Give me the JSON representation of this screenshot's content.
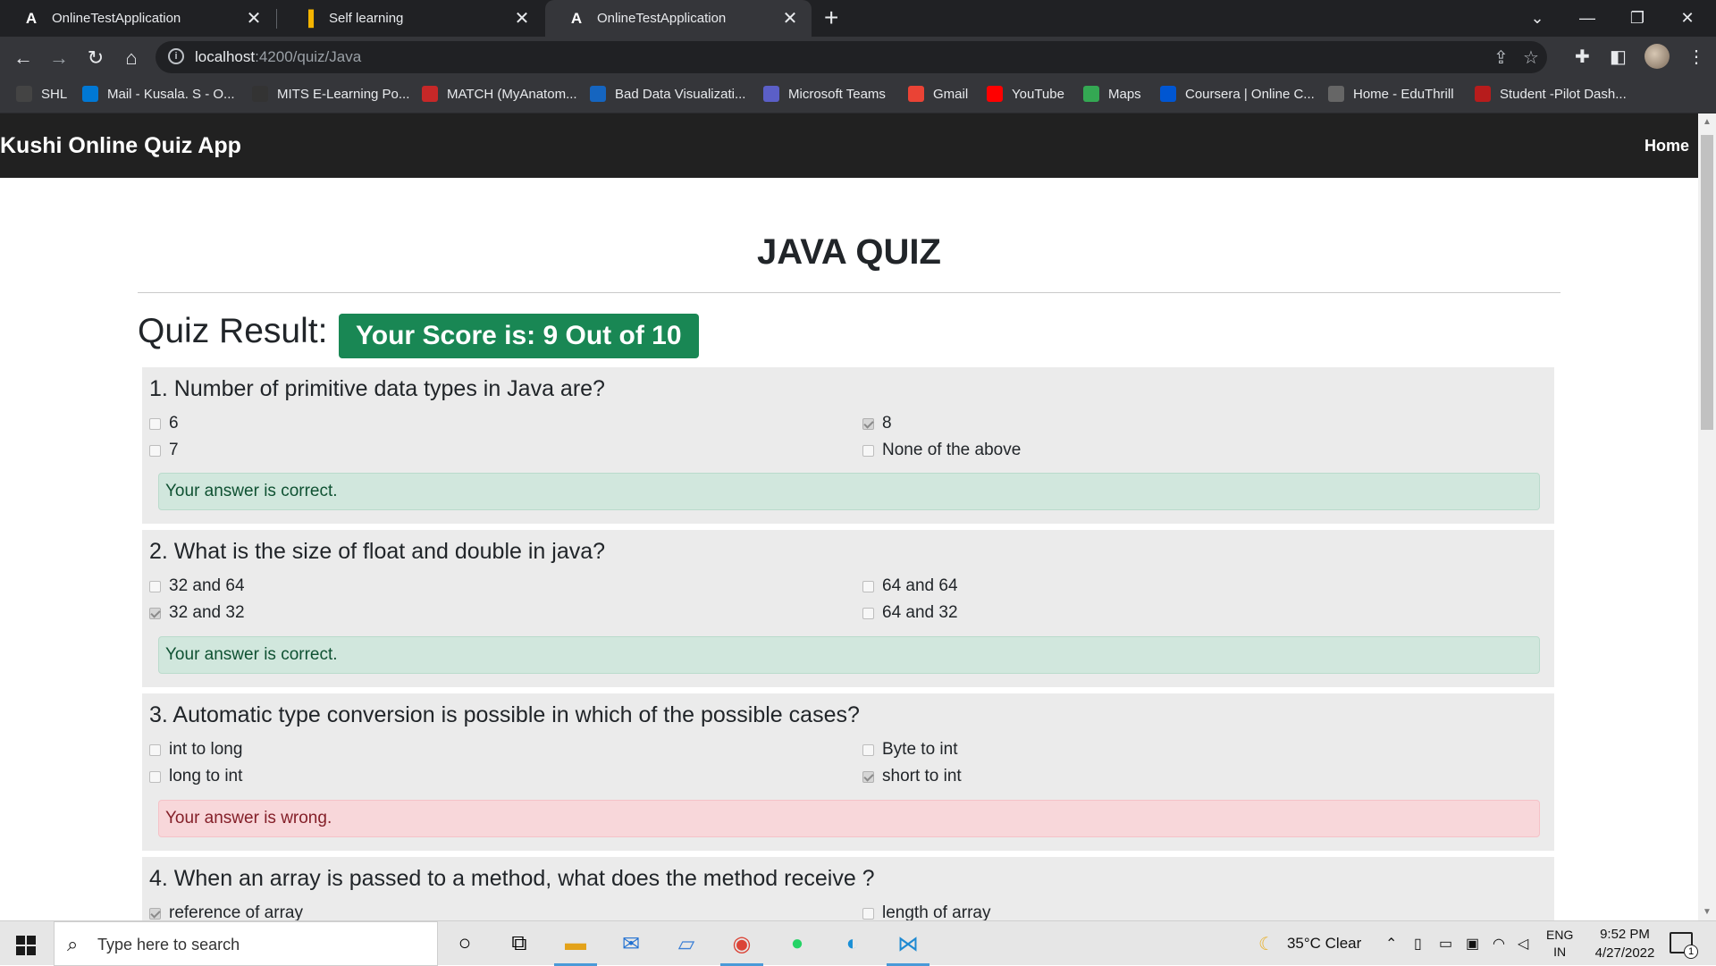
{
  "browser": {
    "tabs": [
      {
        "icon": "angular-icon",
        "title": "OnlineTestApplication",
        "active": false
      },
      {
        "icon": "chart-icon",
        "title": "Self learning",
        "active": false
      },
      {
        "icon": "angular-icon",
        "title": "OnlineTestApplication",
        "active": true
      }
    ],
    "url_host": "localhost",
    "url_path": ":4200/quiz/Java",
    "bookmarks": [
      {
        "label": "SHL",
        "color": "#444"
      },
      {
        "label": "Mail - Kusala. S - O...",
        "color": "#0078d4"
      },
      {
        "label": "MITS E-Learning Po...",
        "color": "#333"
      },
      {
        "label": "MATCH (MyAnatom...",
        "color": "#c62828"
      },
      {
        "label": "Bad Data Visualizati...",
        "color": "#1565c0"
      },
      {
        "label": "Microsoft Teams",
        "color": "#5b5fc7"
      },
      {
        "label": "Gmail",
        "color": "#ea4335"
      },
      {
        "label": "YouTube",
        "color": "#ff0000"
      },
      {
        "label": "Maps",
        "color": "#34a853"
      },
      {
        "label": "Coursera | Online C...",
        "color": "#0056d2"
      },
      {
        "label": "Home - EduThrill",
        "color": "#666"
      },
      {
        "label": "Student -Pilot Dash...",
        "color": "#b71c1c"
      }
    ]
  },
  "app": {
    "brand": "Kushi Online Quiz App",
    "home_link": "Home",
    "quiz_title": "JAVA QUIZ",
    "result_label": "Quiz Result:",
    "score_text": "Your Score is: 9 Out of 10"
  },
  "questions": [
    {
      "text": "1. Number of primitive data types in Java are?",
      "options": [
        {
          "label": "6",
          "checked": false
        },
        {
          "label": "8",
          "checked": true
        },
        {
          "label": "7",
          "checked": false
        },
        {
          "label": "None of the above",
          "checked": false
        }
      ],
      "feedback": "Your answer is correct.",
      "correct": true
    },
    {
      "text": "2. What is the size of float and double in java?",
      "options": [
        {
          "label": "32 and 64",
          "checked": false
        },
        {
          "label": "64 and 64",
          "checked": false
        },
        {
          "label": "32 and 32",
          "checked": true
        },
        {
          "label": "64 and 32",
          "checked": false
        }
      ],
      "feedback": "Your answer is correct.",
      "correct": true
    },
    {
      "text": "3. Automatic type conversion is possible in which of the possible cases?",
      "options": [
        {
          "label": "int to long",
          "checked": false
        },
        {
          "label": "Byte to int",
          "checked": false
        },
        {
          "label": "long to int",
          "checked": false
        },
        {
          "label": "short to int",
          "checked": true
        }
      ],
      "feedback": "Your answer is wrong.",
      "correct": false
    },
    {
      "text": "4. When an array is passed to a method, what does the method receive ?",
      "options": [
        {
          "label": "reference of array",
          "checked": true
        },
        {
          "label": "length of array",
          "checked": false
        }
      ]
    }
  ],
  "taskbar": {
    "search_placeholder": "Type here to search",
    "weather": "35°C  Clear",
    "lang_1": "ENG",
    "lang_2": "IN",
    "time": "9:52 PM",
    "date": "4/27/2022",
    "notification_count": "1"
  },
  "colors": {
    "navbar": "#212121",
    "score_badge": "#198754",
    "alert_success_bg": "#d1e7dd",
    "alert_danger_bg": "#f8d7da"
  }
}
